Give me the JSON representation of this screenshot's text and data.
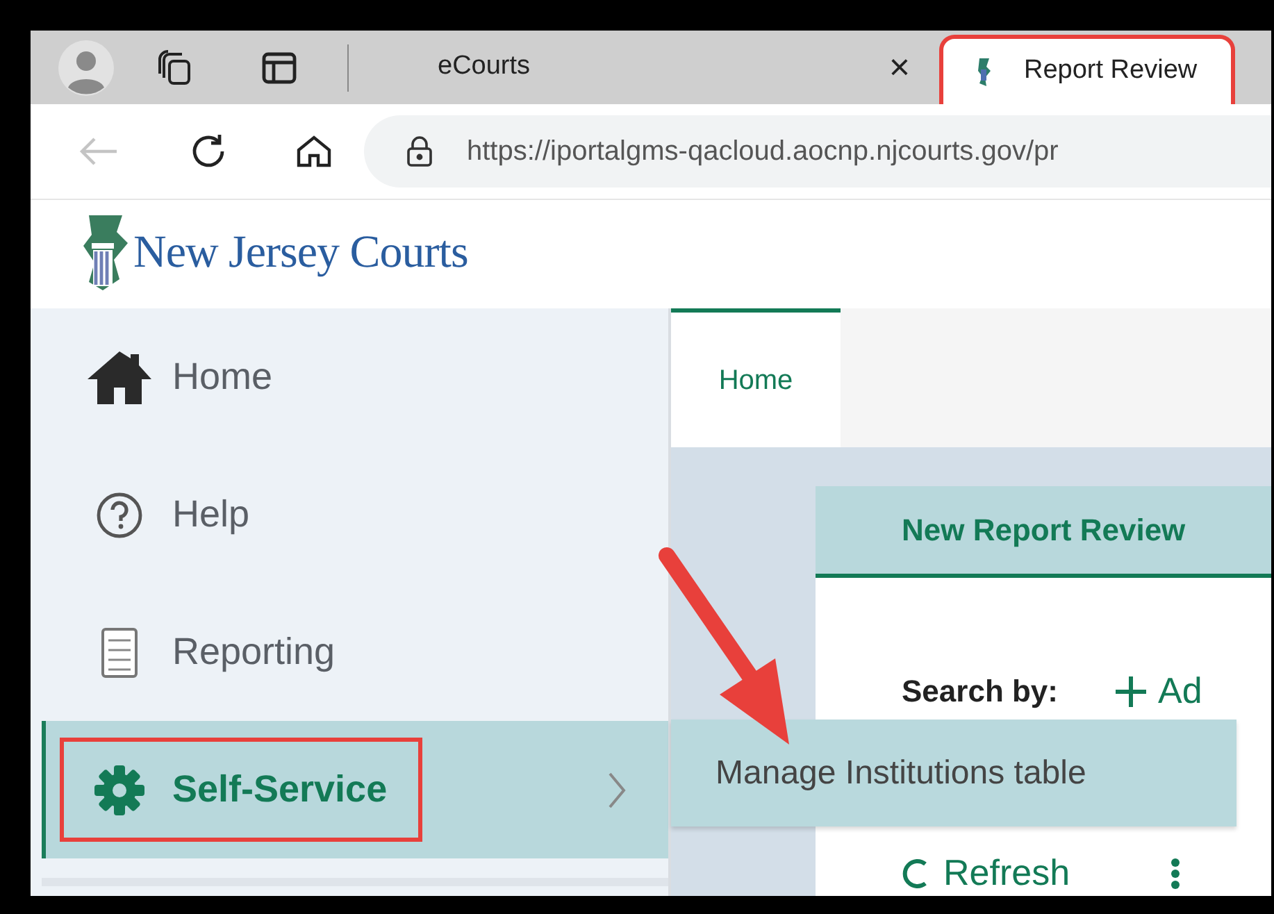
{
  "browser": {
    "tabs": [
      {
        "title": "eCourts",
        "selected": false,
        "closable": true,
        "close_glyph": "×",
        "highlighted": false
      },
      {
        "title": "Report Review",
        "selected": true,
        "closable": false,
        "highlighted": true
      }
    ],
    "back_disabled": true,
    "url": "https://iportalgms-qacloud.aocnp.njcourts.gov/pr"
  },
  "logo": {
    "text": "New Jersey Courts"
  },
  "sidebar": {
    "items": [
      {
        "kind": "home",
        "label": "Home",
        "selected": false,
        "highlighted": false,
        "has_submenu": false
      },
      {
        "kind": "help",
        "label": "Help",
        "selected": false,
        "highlighted": false,
        "has_submenu": false
      },
      {
        "kind": "reporting",
        "label": "Reporting",
        "selected": false,
        "highlighted": false,
        "has_submenu": false
      },
      {
        "kind": "gear",
        "label": "Self-Service",
        "selected": true,
        "highlighted": true,
        "has_submenu": true
      }
    ]
  },
  "page_tabs": [
    {
      "label": "Home",
      "selected": true
    }
  ],
  "card": {
    "title": "New Report Review",
    "search_label": "Search by:",
    "add_label": "Ad",
    "refresh_label": "Refresh"
  },
  "submenu": {
    "items": [
      {
        "label": "Manage Institutions table"
      }
    ]
  },
  "callout_arrow": true
}
